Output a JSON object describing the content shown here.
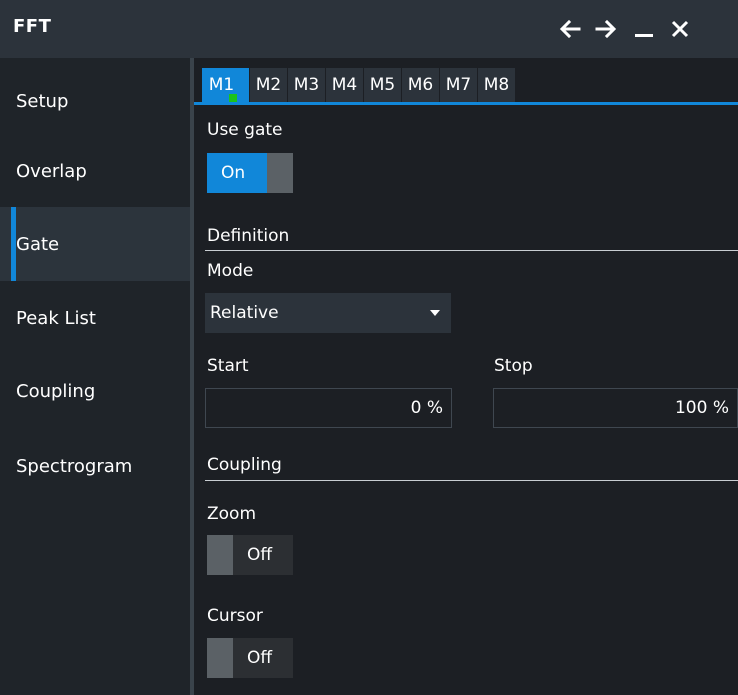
{
  "window": {
    "title": "FFT"
  },
  "titlebar_icons": [
    "arrow-left-icon",
    "arrow-right-icon",
    "minimize-icon",
    "close-icon"
  ],
  "sidebar": {
    "items": [
      {
        "label": "Setup",
        "active": false
      },
      {
        "label": "Overlap",
        "active": false
      },
      {
        "label": "Gate",
        "active": true
      },
      {
        "label": "Peak List",
        "active": false
      },
      {
        "label": "Coupling",
        "active": false
      },
      {
        "label": "Spectrogram",
        "active": false
      }
    ]
  },
  "tabs": [
    {
      "label": "M1",
      "active": true
    },
    {
      "label": "M2",
      "active": false
    },
    {
      "label": "M3",
      "active": false
    },
    {
      "label": "M4",
      "active": false
    },
    {
      "label": "M5",
      "active": false
    },
    {
      "label": "M6",
      "active": false
    },
    {
      "label": "M7",
      "active": false
    },
    {
      "label": "M8",
      "active": false
    }
  ],
  "use_gate": {
    "label": "Use gate",
    "value": "On"
  },
  "definition": {
    "heading": "Definition",
    "mode_label": "Mode",
    "mode_value": "Relative",
    "start_label": "Start",
    "start_value": "0 %",
    "stop_label": "Stop",
    "stop_value": "100 %"
  },
  "coupling": {
    "heading": "Coupling",
    "zoom_label": "Zoom",
    "zoom_value": "Off",
    "cursor_label": "Cursor",
    "cursor_value": "Off"
  },
  "colors": {
    "accent": "#1187d9",
    "titlebar": "#2c333b",
    "background": "#1c1f24",
    "status_dot": "#1cc31c"
  }
}
